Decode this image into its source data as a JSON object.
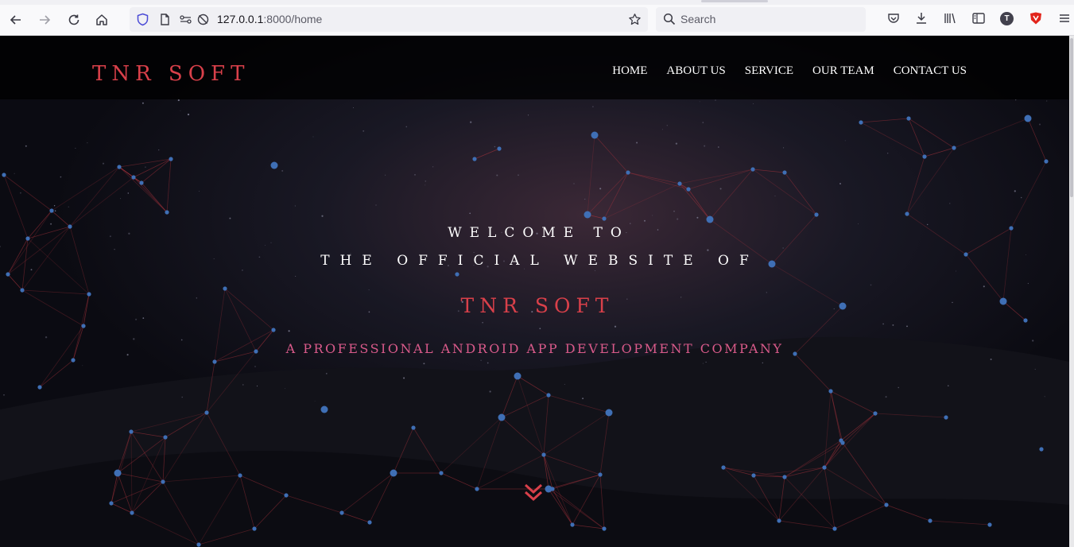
{
  "browser": {
    "url_host": "127.0.0.1",
    "url_path": ":8000/home",
    "search_placeholder": "Search",
    "profile_initial": "T"
  },
  "site": {
    "logo": "TNR SOFT",
    "menu": [
      {
        "label": "HOME"
      },
      {
        "label": "ABOUT US"
      },
      {
        "label": "SERVICE"
      },
      {
        "label": "OUR TEAM"
      },
      {
        "label": "CONTACT US"
      }
    ]
  },
  "hero": {
    "line1": "WELCOME TO",
    "line2": "THE OFFICIAL WEBSITE OF",
    "brand": "TNR SOFT",
    "tagline": "A PROFESSIONAL ANDROID APP DEVELOPMENT COMPANY"
  },
  "colors": {
    "accent": "#d9404a",
    "tagline": "#d95a8a",
    "network_line": "#b2343e",
    "network_node": "#3f6fb5"
  }
}
